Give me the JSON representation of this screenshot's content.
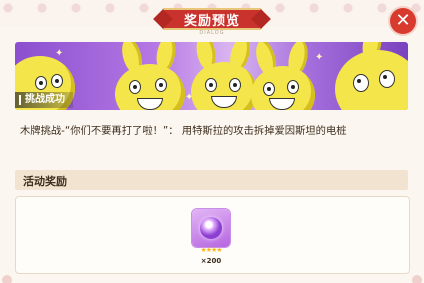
{
  "dialog": {
    "title": "奖励预览",
    "subtitle": "DIALOG",
    "close_symbol": "✕"
  },
  "banner": {
    "status_label": "挑战成功"
  },
  "task": {
    "description": "木牌挑战-“你们不要再打了啦！”： 用特斯拉的攻击拆掉爱因斯坦的电桩"
  },
  "rewards": {
    "section_title": "活动奖励",
    "items": [
      {
        "icon": "purple-gem-icon",
        "stars": "★★★★",
        "quantity": "×200"
      }
    ]
  },
  "colors": {
    "title_red": "#c9322d",
    "close_red": "#d83a2e",
    "banner_purple": "#8b4fcf",
    "bunny_yellow": "#f4e54a",
    "star_gold": "#f5b91a"
  }
}
